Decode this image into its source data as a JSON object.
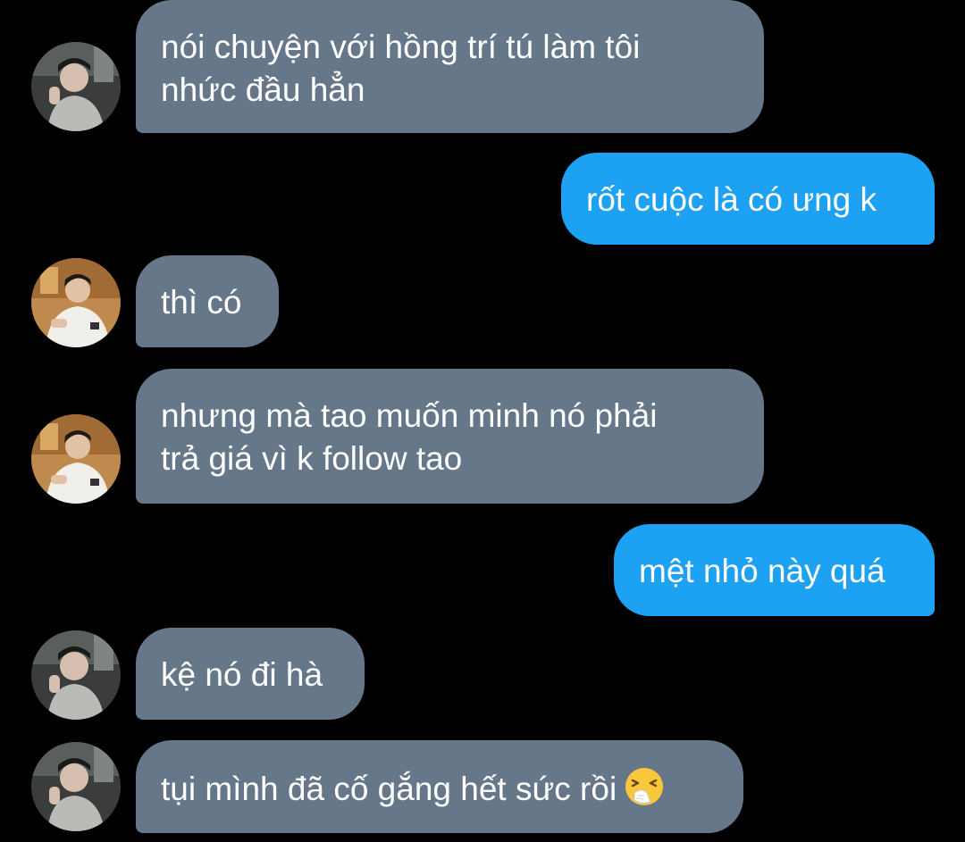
{
  "conversation": {
    "messages": [
      {
        "from": "them",
        "avatar": "avatar-grey-sweater",
        "lines": [
          "nói chuyện với hồng trí tú làm tôi",
          "nhức đầu hẳn"
        ]
      },
      {
        "from": "me",
        "lines": [
          "rốt cuộc là có ưng k"
        ]
      },
      {
        "from": "them",
        "avatar": "avatar-white-hoodie",
        "lines": [
          "thì có"
        ]
      },
      {
        "from": "them",
        "avatar": "avatar-white-hoodie",
        "lines": [
          "nhưng mà tao muốn minh nó phải",
          "trả giá vì k follow tao"
        ]
      },
      {
        "from": "me",
        "lines": [
          "mệt nhỏ này quá"
        ]
      },
      {
        "from": "them",
        "avatar": "avatar-grey-sweater",
        "lines": [
          "kệ nó đi hà"
        ]
      },
      {
        "from": "them",
        "avatar": "avatar-grey-sweater",
        "lines": [
          "tụi mình đã cố gắng hết sức rồi"
        ],
        "emoji": "sneezing-face-icon"
      }
    ]
  },
  "colors": {
    "background": "#000000",
    "incoming_bubble": "#66778a",
    "outgoing_bubble": "#1da1f2",
    "text": "#ffffff"
  }
}
